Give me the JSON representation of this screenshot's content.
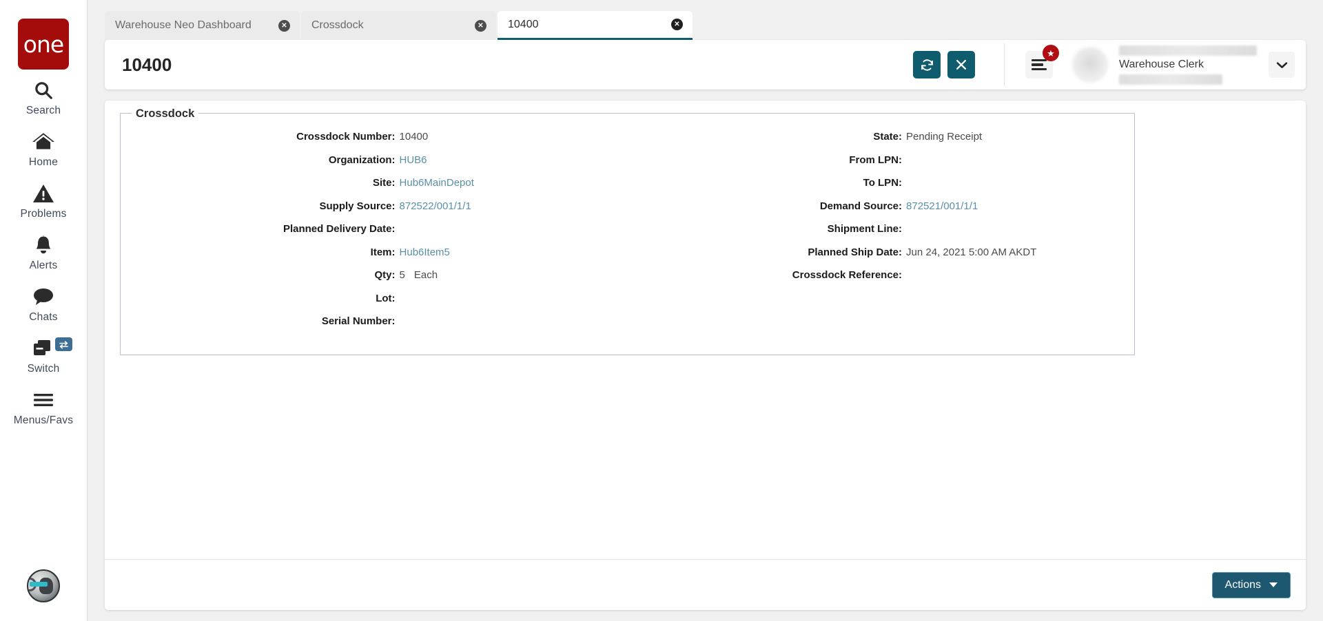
{
  "sidebar": {
    "logo_text": "one",
    "items": [
      {
        "label": "Search",
        "icon": "search-icon"
      },
      {
        "label": "Home",
        "icon": "home-icon"
      },
      {
        "label": "Problems",
        "icon": "warning-triangle-icon"
      },
      {
        "label": "Alerts",
        "icon": "bell-icon"
      },
      {
        "label": "Chats",
        "icon": "chat-bubble-icon"
      },
      {
        "label": "Switch",
        "icon": "windows-stack-icon",
        "badge_icon": "swap-arrows-icon"
      },
      {
        "label": "Menus/Favs",
        "icon": "hamburger-icon"
      }
    ],
    "bottom_avatar": "assistant-avatar-icon"
  },
  "tabs": [
    {
      "label": "Warehouse Neo Dashboard",
      "active": false,
      "close_icon": "close-circle-icon"
    },
    {
      "label": "Crossdock",
      "active": false,
      "close_icon": "close-circle-icon"
    },
    {
      "label": "10400",
      "active": true,
      "close_icon": "close-circle-icon"
    }
  ],
  "header": {
    "title": "10400",
    "refresh_icon": "refresh-icon",
    "close_icon": "close-x-icon",
    "menus_icon": "hamburger-icon",
    "favorites_badge_icon": "star-icon",
    "avatar": "user-avatar",
    "user_role": "Warehouse Clerk",
    "user_name_redacted": "",
    "user_org_redacted": "",
    "dropdown_icon": "chevron-down-icon"
  },
  "form": {
    "legend": "Crossdock",
    "left_column": [
      {
        "label": "Crossdock Number:",
        "value": "10400",
        "link": false
      },
      {
        "label": "Organization:",
        "value": "HUB6",
        "link": true
      },
      {
        "label": "Site:",
        "value": "Hub6MainDepot",
        "link": true
      },
      {
        "label": "Supply Source:",
        "value": "872522/001/1/1",
        "link": true
      },
      {
        "label": "Planned Delivery Date:",
        "value": "",
        "link": false
      },
      {
        "label": "Item:",
        "value": "Hub6Item5",
        "link": true
      },
      {
        "label": "Qty:",
        "value": "5",
        "unit": "Each",
        "link": false
      },
      {
        "label": "Lot:",
        "value": "",
        "link": false
      },
      {
        "label": "Serial Number:",
        "value": "",
        "link": false
      }
    ],
    "right_column": [
      {
        "label": "State:",
        "value": "Pending Receipt",
        "link": false
      },
      {
        "label": "From LPN:",
        "value": "",
        "link": false
      },
      {
        "label": "To LPN:",
        "value": "",
        "link": false
      },
      {
        "label": "Demand Source:",
        "value": "872521/001/1/1",
        "link": true
      },
      {
        "label": "Shipment Line:",
        "value": "",
        "link": false
      },
      {
        "label": "Planned Ship Date:",
        "value": "Jun 24, 2021 5:00 AM AKDT",
        "link": false
      },
      {
        "label": "Crossdock Reference:",
        "value": "",
        "link": false
      }
    ]
  },
  "footer": {
    "actions_label": "Actions",
    "actions_caret_icon": "caret-down-icon"
  },
  "colors": {
    "brand_red": "#a40b0b",
    "teal": "#0e5c6e",
    "accent_link": "#5a8fa8",
    "actions_btn": "#1e5770",
    "badge_red": "#b00c13"
  }
}
